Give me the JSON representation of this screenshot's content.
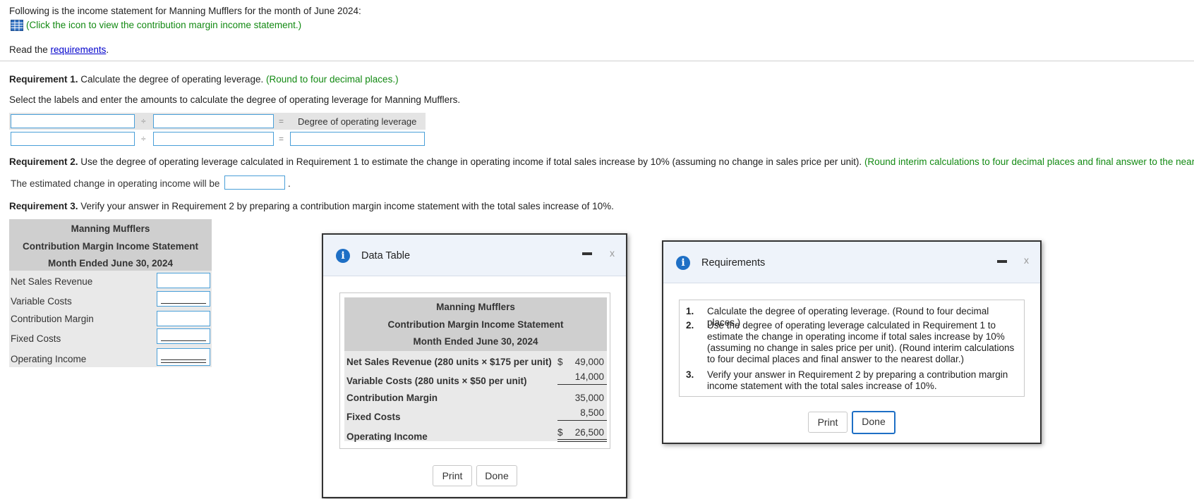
{
  "intro": {
    "text": "Following is the income statement for Manning Mufflers for the month of June 2024:",
    "icon_note": "(Click the icon to view the contribution margin income statement.)",
    "read_prefix": "Read the ",
    "read_link": "requirements",
    "read_suffix": "."
  },
  "req1": {
    "heading": "Requirement 1.",
    "text": " Calculate the degree of operating leverage.",
    "hint": " (Round to four decimal places.)",
    "instruction": "Select the labels and enter the amounts to calculate the degree of operating leverage for Manning Mufflers.",
    "op_divide": "÷",
    "op_equals": "=",
    "result_label": "Degree of operating leverage"
  },
  "req2": {
    "heading": "Requirement 2.",
    "text": " Use the degree of operating leverage calculated in Requirement 1 to estimate the change in operating income if total sales increase by 10% (assuming no change in sales price per unit).",
    "hint": " (Round interim calculations to four decimal places and final answer to the nearest dollar.)",
    "answer_prefix": "The estimated change in operating income will be",
    "answer_suffix": "."
  },
  "req3": {
    "heading": "Requirement 3.",
    "text": " Verify your answer in Requirement 2 by preparing a contribution margin income statement with the total sales increase of 10%."
  },
  "statement": {
    "company": "Manning Mufflers",
    "title": "Contribution Margin Income Statement",
    "period": "Month Ended June 30, 2024",
    "rows": [
      "Net Sales Revenue",
      "Variable Costs",
      "Contribution Margin",
      "Fixed Costs",
      "Operating Income"
    ]
  },
  "data_table_dialog": {
    "title": "Data Table",
    "company": "Manning Mufflers",
    "statement_title": "Contribution Margin Income Statement",
    "period": "Month Ended June 30, 2024",
    "rows": [
      {
        "label": "Net Sales Revenue (280 units × $175 per unit)",
        "dollar": "$",
        "value": "49,000"
      },
      {
        "label": "Variable Costs (280 units × $50 per unit)",
        "dollar": "",
        "value": "14,000"
      },
      {
        "label": "Contribution Margin",
        "dollar": "",
        "value": "35,000"
      },
      {
        "label": "Fixed Costs",
        "dollar": "",
        "value": "8,500"
      },
      {
        "label": "Operating Income",
        "dollar": "$",
        "value": "26,500"
      }
    ],
    "print_label": "Print",
    "done_label": "Done",
    "close_glyph": "x"
  },
  "requirements_dialog": {
    "title": "Requirements",
    "items": [
      {
        "num": "1.",
        "text": "Calculate the degree of operating leverage. (Round to four decimal places.)"
      },
      {
        "num": "2.",
        "text": "Use the degree of operating leverage calculated in Requirement 1 to estimate the change in operating income if total sales increase by 10% (assuming no change in sales price per unit). (Round interim calculations to four decimal places and final answer to the nearest dollar.)"
      },
      {
        "num": "3.",
        "text": "Verify your answer in Requirement 2 by preparing a contribution margin income statement with the total sales increase of 10%."
      }
    ],
    "print_label": "Print",
    "done_label": "Done",
    "close_glyph": "x"
  },
  "colors": {
    "hint_green": "#138a13",
    "input_border": "#4a9fd8",
    "info_blue": "#1e6fc5",
    "link_blue": "#0000cc"
  },
  "icons": {
    "table_icon": "table-icon",
    "info_icon": "info-icon",
    "minimize_icon": "minimize-icon",
    "close_icon": "close-icon"
  }
}
